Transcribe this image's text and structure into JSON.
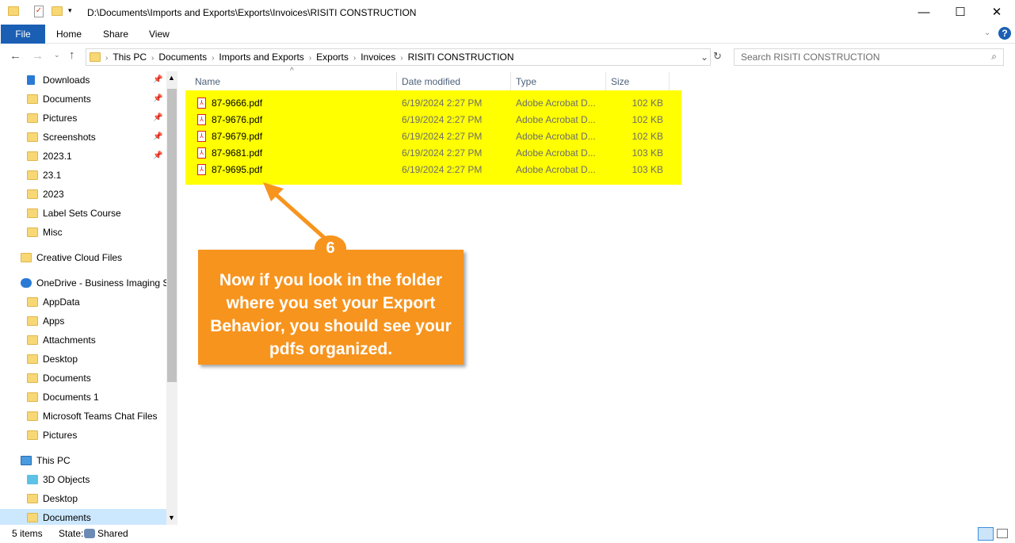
{
  "window": {
    "title": "D:\\Documents\\Imports and Exports\\Exports\\Invoices\\RISITI CONSTRUCTION",
    "minimize": "—",
    "maximize": "☐",
    "close": "✕"
  },
  "ribbon": {
    "tabs": [
      "File",
      "Home",
      "Share",
      "View"
    ]
  },
  "address": {
    "crumbs": [
      "This PC",
      "Documents",
      "Imports and Exports",
      "Exports",
      "Invoices",
      "RISITI CONSTRUCTION"
    ]
  },
  "search": {
    "placeholder": "Search RISITI CONSTRUCTION"
  },
  "sidebar": {
    "items": [
      {
        "label": "Downloads",
        "pinned": true
      },
      {
        "label": "Documents",
        "pinned": true
      },
      {
        "label": "Pictures",
        "pinned": true
      },
      {
        "label": "Screenshots",
        "pinned": true
      },
      {
        "label": "2023.1",
        "pinned": true
      },
      {
        "label": "23.1"
      },
      {
        "label": "2023"
      },
      {
        "label": "Label Sets Course"
      },
      {
        "label": "Misc"
      },
      {
        "label": "Creative Cloud Files"
      },
      {
        "label": "OneDrive - Business Imaging Sy"
      },
      {
        "label": "AppData"
      },
      {
        "label": "Apps"
      },
      {
        "label": "Attachments"
      },
      {
        "label": "Desktop"
      },
      {
        "label": "Documents"
      },
      {
        "label": "Documents 1"
      },
      {
        "label": "Microsoft Teams Chat Files"
      },
      {
        "label": "Pictures"
      },
      {
        "label": "This PC"
      },
      {
        "label": "3D Objects"
      },
      {
        "label": "Desktop"
      },
      {
        "label": "Documents"
      }
    ]
  },
  "columns": [
    "Name",
    "Date modified",
    "Type",
    "Size"
  ],
  "files": [
    {
      "name": "87-9666.pdf",
      "date": "6/19/2024 2:27 PM",
      "type": "Adobe Acrobat D...",
      "size": "102 KB"
    },
    {
      "name": "87-9676.pdf",
      "date": "6/19/2024 2:27 PM",
      "type": "Adobe Acrobat D...",
      "size": "102 KB"
    },
    {
      "name": "87-9679.pdf",
      "date": "6/19/2024 2:27 PM",
      "type": "Adobe Acrobat D...",
      "size": "102 KB"
    },
    {
      "name": "87-9681.pdf",
      "date": "6/19/2024 2:27 PM",
      "type": "Adobe Acrobat D...",
      "size": "103 KB"
    },
    {
      "name": "87-9695.pdf",
      "date": "6/19/2024 2:27 PM",
      "type": "Adobe Acrobat D...",
      "size": "103 KB"
    }
  ],
  "status": {
    "count": "5 items",
    "state_label": "State:",
    "state_value": "Shared"
  },
  "callout": {
    "step": "6",
    "text": "Now if you look in the folder where you set your Export Behavior, you should see your pdfs organized.",
    "color": "#F7941D"
  }
}
